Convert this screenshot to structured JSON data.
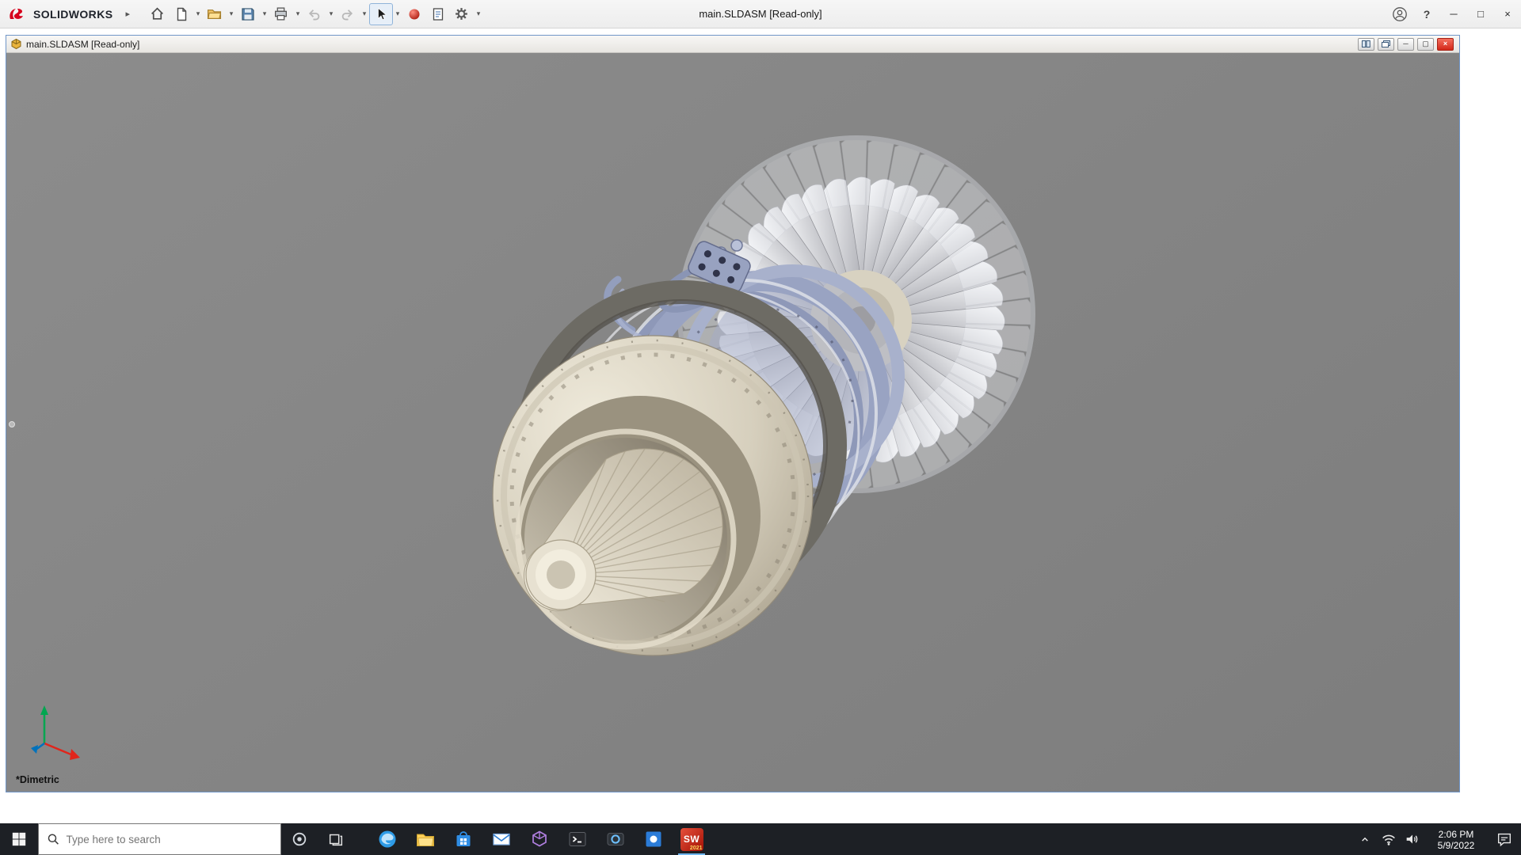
{
  "app": {
    "brand": "SOLIDWORKS",
    "window_title": "main.SLDASM [Read-only]",
    "toolbar_items": [
      "home",
      "new-document",
      "open",
      "save",
      "print",
      "undo",
      "redo",
      "select",
      "record-macro",
      "file-properties",
      "options"
    ],
    "right_items": [
      "account",
      "help",
      "minimize",
      "maximize",
      "close"
    ]
  },
  "glyphs": {
    "flyout_arrow": "▸",
    "caret": "▾",
    "help": "?",
    "minimize": "─",
    "maximize": "□",
    "close": "×",
    "child_minimize": "─",
    "child_restore": "▢",
    "child_close": "×"
  },
  "child_window": {
    "title": "main.SLDASM [Read-only]"
  },
  "viewport": {
    "orientation_label": "*Dimetric",
    "model": "turbofan-jet-engine-assembly"
  },
  "taskbar": {
    "search_placeholder": "Type here to search",
    "clock_time": "2:06 PM",
    "clock_date": "5/9/2022",
    "solidworks_badge": "SW",
    "solidworks_year": "2021",
    "app_icons": [
      "edge",
      "file-explorer",
      "store",
      "mail",
      "3d-viewer",
      "terminal",
      "camera",
      "photos",
      "solidworks"
    ],
    "tray_icons": [
      "hidden-icons-chevron",
      "network",
      "volume",
      "clock",
      "action-center"
    ]
  },
  "colors": {
    "viewport_bg": "#838383",
    "taskbar_bg": "#1d2025",
    "brand_red": "#d6001c",
    "close_red": "#d32718",
    "engine_cream": "#d6cfbd",
    "engine_blue": "#99a3c2"
  }
}
